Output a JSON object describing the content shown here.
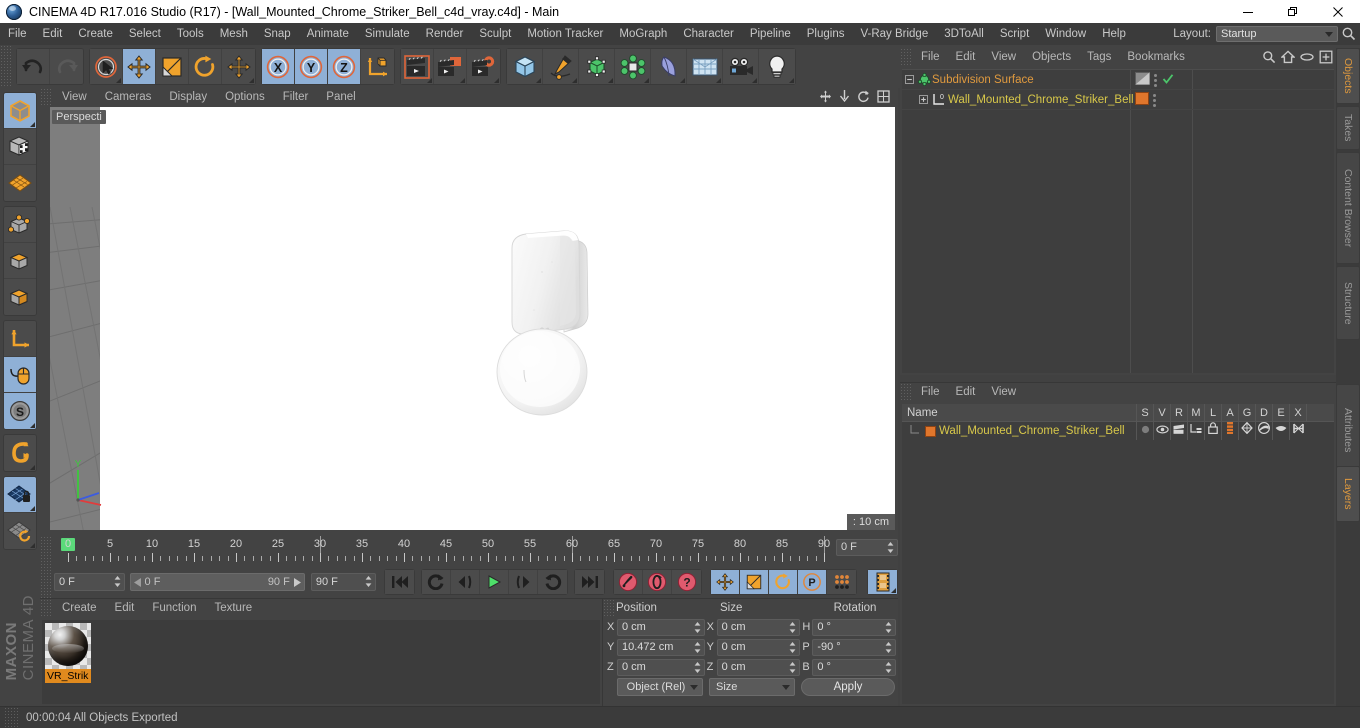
{
  "window": {
    "title": "CINEMA 4D R17.016 Studio (R17) - [Wall_Mounted_Chrome_Striker_Bell_c4d_vray.c4d] - Main",
    "minimize": "—",
    "maximize": "❐",
    "close": "✕"
  },
  "menubar": {
    "items": [
      "File",
      "Edit",
      "Create",
      "Select",
      "Tools",
      "Mesh",
      "Snap",
      "Animate",
      "Simulate",
      "Render",
      "Sculpt",
      "Motion Tracker",
      "MoGraph",
      "Character",
      "Pipeline",
      "Plugins",
      "V-Ray Bridge",
      "3DToAll",
      "Script",
      "Window",
      "Help"
    ],
    "layout_label": "Layout:",
    "layout_value": "Startup"
  },
  "viewport": {
    "menu": [
      "View",
      "Cameras",
      "Display",
      "Options",
      "Filter",
      "Panel"
    ],
    "label": "Perspecti",
    "scale": ": 10 cm",
    "axis": {
      "y": "Y"
    }
  },
  "timeline": {
    "ticks": [
      "0",
      "5",
      "10",
      "15",
      "20",
      "25",
      "30",
      "35",
      "40",
      "45",
      "50",
      "55",
      "60",
      "65",
      "70",
      "75",
      "80",
      "85",
      "90"
    ],
    "current_frame_right": "0 F"
  },
  "playbar": {
    "current_frame": "0 F",
    "range_start": "0 F",
    "range_end": "90 F",
    "end_frame": "90 F"
  },
  "material_manager": {
    "menu": [
      "Create",
      "Edit",
      "Function",
      "Texture"
    ],
    "materials": [
      {
        "name": "VR_Strik"
      }
    ]
  },
  "coordinates": {
    "headers": {
      "position": "Position",
      "size": "Size",
      "rotation": "Rotation"
    },
    "axes": {
      "x": "X",
      "y": "Y",
      "z": "Z",
      "h": "H",
      "p": "P",
      "b": "B"
    },
    "position": {
      "x": "0 cm",
      "y": "10.472 cm",
      "z": "0 cm"
    },
    "size": {
      "x": "0 cm",
      "y": "0 cm",
      "z": "0 cm"
    },
    "rotation": {
      "h": "0 °",
      "p": "-90 °",
      "b": "0 °"
    },
    "mode_dropdown": "Object (Rel)",
    "size_dropdown": "Size",
    "apply_button": "Apply"
  },
  "object_manager": {
    "menu": [
      "File",
      "Edit",
      "View",
      "Objects",
      "Tags",
      "Bookmarks"
    ],
    "rows": [
      {
        "name": "Subdivision Surface",
        "color": "orange",
        "indent": 0,
        "level": ""
      },
      {
        "name": "Wall_Mounted_Chrome_Striker_Bell",
        "color": "yellow",
        "indent": 1,
        "level": "0"
      }
    ]
  },
  "layer_manager": {
    "menu": [
      "File",
      "Edit",
      "View"
    ],
    "name_header": "Name",
    "columns": [
      "S",
      "V",
      "R",
      "M",
      "L",
      "A",
      "G",
      "D",
      "E",
      "X"
    ],
    "rows": [
      {
        "name": "Wall_Mounted_Chrome_Striker_Bell"
      }
    ]
  },
  "vertical_tabs": [
    {
      "label": "Objects",
      "active": true
    },
    {
      "label": "Takes",
      "active": false
    },
    {
      "label": "Content Browser",
      "active": false
    },
    {
      "label": "Structure",
      "active": false
    },
    {
      "label": "Attributes",
      "active": false
    },
    {
      "label": "Layers",
      "active": true
    }
  ],
  "branding": {
    "line1": "MAXON",
    "line2": "CINEMA 4D"
  },
  "statusbar": {
    "text": "00:00:04 All Objects Exported"
  },
  "colors": {
    "accent_orange": "#e09a3e",
    "selection_blue": "#8fb0d6",
    "panel_bg": "#434343",
    "green_marker": "#5bd97a"
  }
}
